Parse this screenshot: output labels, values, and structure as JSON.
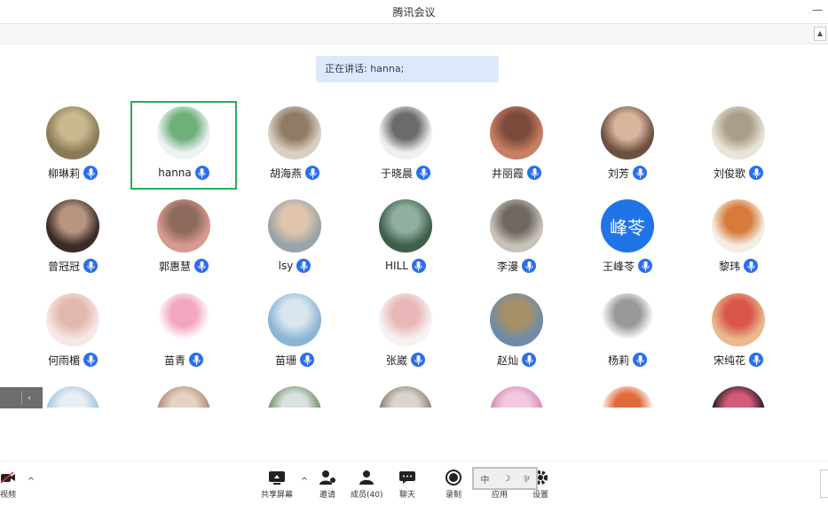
{
  "window": {
    "title": "腾讯会议"
  },
  "speaking": {
    "text": "正在讲话: hanna;"
  },
  "participants": [
    {
      "name": "柳琳莉",
      "avatar": "#8a7a57",
      "avatar2": "#c9b98f"
    },
    {
      "name": "hanna",
      "avatar": "#eef2f4",
      "avatar2": "#6fb07a",
      "active": true
    },
    {
      "name": "胡海燕",
      "avatar": "#d9d0c4",
      "avatar2": "#8f7b66"
    },
    {
      "name": "于晓晨",
      "avatar": "#efefef",
      "avatar2": "#6b6b6b"
    },
    {
      "name": "井丽霞",
      "avatar": "#c97f63",
      "avatar2": "#7c4a3b"
    },
    {
      "name": "刘芳",
      "avatar": "#6d5140",
      "avatar2": "#d8b59d"
    },
    {
      "name": "刘俊歌",
      "avatar": "#e9e4d8",
      "avatar2": "#a99e89"
    },
    {
      "name": "曾冠冠",
      "avatar": "#3a2b26",
      "avatar2": "#b79581"
    },
    {
      "name": "郭惠慧",
      "avatar": "#d79a8e",
      "avatar2": "#8c6a5c"
    },
    {
      "name": "lsy",
      "avatar": "#9aa3a8",
      "avatar2": "#e1c6ad"
    },
    {
      "name": "HILL",
      "avatar": "#3f5f4b",
      "avatar2": "#8fb0a0"
    },
    {
      "name": "李漫",
      "avatar": "#c8c2bb",
      "avatar2": "#6f6761"
    },
    {
      "name": "王峰苓",
      "avatar": "#1f74e8",
      "avatar_text": "峰苓"
    },
    {
      "name": "黎玮",
      "avatar": "#f4ede2",
      "avatar2": "#d77a3a"
    },
    {
      "name": "何雨楣",
      "avatar": "#f6e8e4",
      "avatar2": "#e2b7ad"
    },
    {
      "name": "苗青",
      "avatar": "#ffffff",
      "avatar2": "#f2a6c1"
    },
    {
      "name": "苗珊",
      "avatar": "#8bb5d6",
      "avatar2": "#d9e6ee"
    },
    {
      "name": "张崴",
      "avatar": "#f7f2f0",
      "avatar2": "#e9b7b7"
    },
    {
      "name": "赵灿",
      "avatar": "#6f8ba8",
      "avatar2": "#a79068"
    },
    {
      "name": "杨莉",
      "avatar": "#ffffff",
      "avatar2": "#999999"
    },
    {
      "name": "宋纯花",
      "avatar": "#e9b98f",
      "avatar2": "#d9564a"
    },
    {
      "name": "",
      "avatar": "#9fc4de",
      "avatar2": "#e8eef2"
    },
    {
      "name": "",
      "avatar": "#b08a74",
      "avatar2": "#e4d2c3"
    },
    {
      "name": "",
      "avatar": "#6f8f6a",
      "avatar2": "#d9e0df"
    },
    {
      "name": "",
      "avatar": "#8b8170",
      "avatar2": "#dad5cc"
    },
    {
      "name": "",
      "avatar": "#d38ab8",
      "avatar2": "#f4c9df"
    },
    {
      "name": "",
      "avatar": "#ffffff",
      "avatar2": "#e06b3a"
    },
    {
      "name": "",
      "avatar": "#1b1b1b",
      "avatar2": "#d45a7a"
    }
  ],
  "toolbar": {
    "video_label": "视频",
    "share_label": "共享屏幕",
    "invite_label": "邀请",
    "members_label": "成员(40)",
    "chat_label": "聊天",
    "record_label": "录制",
    "apps_label": "应用",
    "settings_label": "设置"
  },
  "ime": {
    "c1": "中",
    "c2": "☽",
    "c3": "⅌"
  }
}
